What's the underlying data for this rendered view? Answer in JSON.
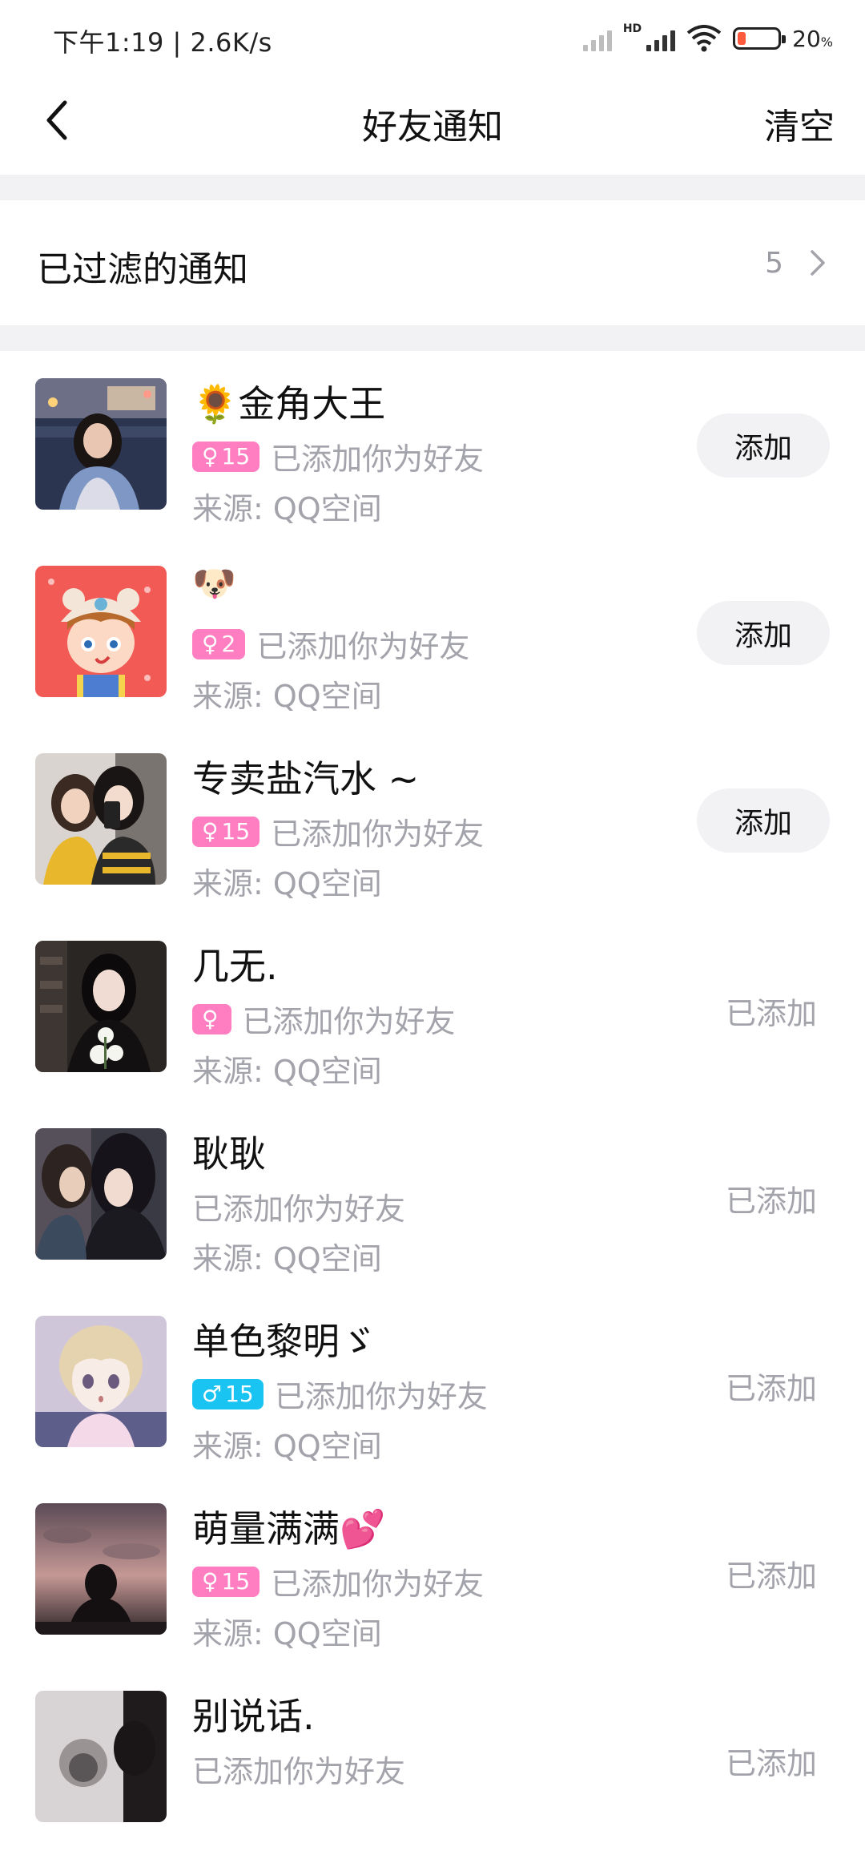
{
  "status_bar": {
    "time": "下午1:19 | 2.6K/s",
    "hd": "HD",
    "battery_level": 20,
    "battery_text": "20",
    "battery_unit": "%"
  },
  "nav": {
    "back_icon": "chevron-left-icon",
    "title": "好友通知",
    "clear_label": "清空"
  },
  "filtered": {
    "label": "已过滤的通知",
    "count": "5",
    "icon": "chevron-right-icon"
  },
  "colors": {
    "female_badge": "#ff7ec1",
    "male_badge": "#19c3f2",
    "secondary_text": "#a3a3ab",
    "button_bg": "#f2f2f5"
  },
  "items": [
    {
      "name": "🌻金角大王",
      "badge_gender": "♀",
      "badge_age": "15",
      "badge_type": "f",
      "message": "已添加你为好友",
      "source": "来源: QQ空间",
      "action": "添加",
      "state": "pending"
    },
    {
      "name": "🐶",
      "badge_gender": "♀",
      "badge_age": "2",
      "badge_type": "f",
      "message": "已添加你为好友",
      "source": "来源: QQ空间",
      "action": "添加",
      "state": "pending"
    },
    {
      "name": "专卖盐汽水 ~",
      "badge_gender": "♀",
      "badge_age": "15",
      "badge_type": "f",
      "message": "已添加你为好友",
      "source": "来源: QQ空间",
      "action": "添加",
      "state": "pending"
    },
    {
      "name": "几无.",
      "badge_gender": "♀",
      "badge_age": "",
      "badge_type": "f",
      "message": "已添加你为好友",
      "source": "来源: QQ空间",
      "action": "已添加",
      "state": "added"
    },
    {
      "name": "耿耿",
      "badge_gender": "",
      "badge_age": "",
      "badge_type": "",
      "message": "已添加你为好友",
      "source": "来源: QQ空间",
      "action": "已添加",
      "state": "added"
    },
    {
      "name": "单色黎明ゞ",
      "badge_gender": "♂",
      "badge_age": "15",
      "badge_type": "m",
      "message": "已添加你为好友",
      "source": "来源: QQ空间",
      "action": "已添加",
      "state": "added"
    },
    {
      "name": "萌量满满💕",
      "badge_gender": "♀",
      "badge_age": "15",
      "badge_type": "f",
      "message": "已添加你为好友",
      "source": "来源: QQ空间",
      "action": "已添加",
      "state": "added"
    },
    {
      "name": "别说话.",
      "badge_gender": "",
      "badge_age": "",
      "badge_type": "",
      "message": "已添加你为好友",
      "source": "",
      "action": "已添加",
      "state": "added"
    }
  ]
}
